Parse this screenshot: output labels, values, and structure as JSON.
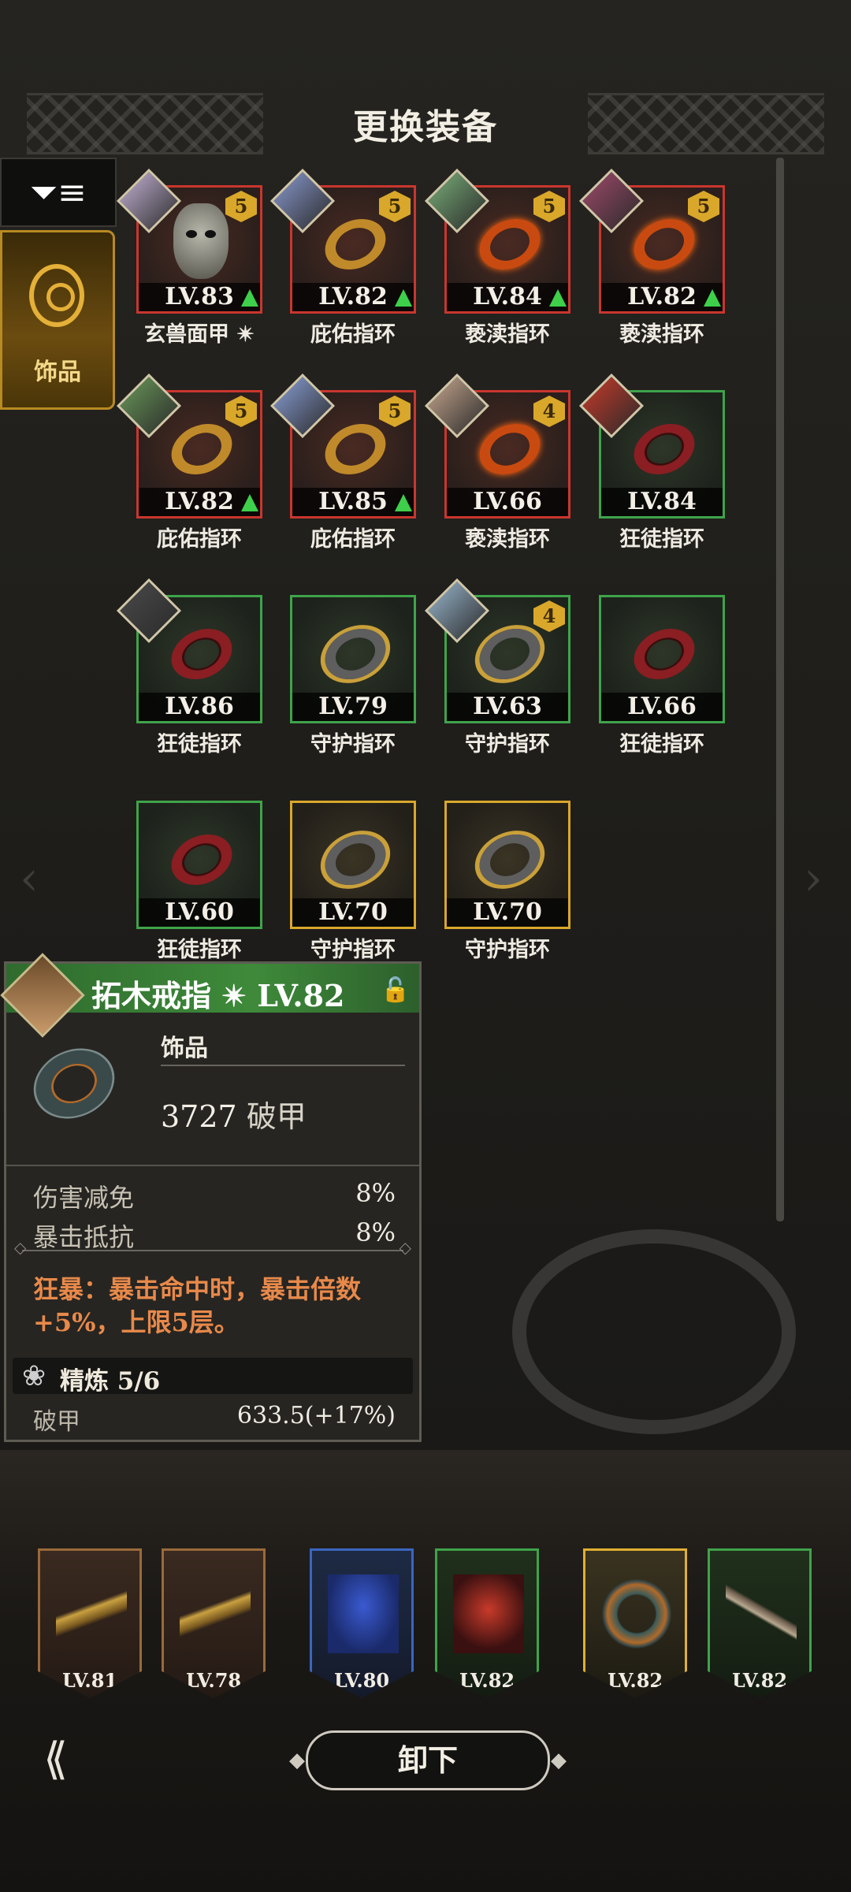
{
  "header": {
    "title": "更换装备"
  },
  "side": {
    "filter_icon": "filter-list-icon",
    "tab_label": "饰品"
  },
  "items": [
    {
      "name": "玄兽面甲 ✴",
      "level": "LV.83",
      "rarity": "red",
      "stars": "5",
      "upgrade": true,
      "type": "mask",
      "avatar": "#c6b4d8"
    },
    {
      "name": "庇佑指环",
      "level": "LV.82",
      "rarity": "red",
      "stars": "5",
      "upgrade": true,
      "type": "gold",
      "avatar": "#8a9ad0"
    },
    {
      "name": "亵渎指环",
      "level": "LV.84",
      "rarity": "red",
      "stars": "5",
      "upgrade": true,
      "type": "flame",
      "avatar": "#7ab07a"
    },
    {
      "name": "亵渎指环",
      "level": "LV.82",
      "rarity": "red",
      "stars": "5",
      "upgrade": true,
      "type": "flame",
      "avatar": "#a04a6a"
    },
    {
      "name": "庇佑指环",
      "level": "LV.82",
      "rarity": "red",
      "stars": "5",
      "upgrade": true,
      "type": "gold",
      "avatar": "#6a9a5a"
    },
    {
      "name": "庇佑指环",
      "level": "LV.85",
      "rarity": "red",
      "stars": "5",
      "upgrade": true,
      "type": "gold",
      "avatar": "#8aa0d8"
    },
    {
      "name": "亵渎指环",
      "level": "LV.66",
      "rarity": "red",
      "stars": "4",
      "upgrade": false,
      "type": "flame",
      "avatar": "#c8a890"
    },
    {
      "name": "狂徒指环",
      "level": "LV.84",
      "rarity": "green",
      "stars": "",
      "upgrade": false,
      "type": "red",
      "avatar": "#c83a2a"
    },
    {
      "name": "狂徒指环",
      "level": "LV.86",
      "rarity": "green",
      "stars": "",
      "upgrade": false,
      "type": "red",
      "avatar": "#4a4a4a"
    },
    {
      "name": "守护指环",
      "level": "LV.79",
      "rarity": "green",
      "stars": "",
      "upgrade": false,
      "type": "dark",
      "avatar": ""
    },
    {
      "name": "守护指环",
      "level": "LV.63",
      "rarity": "green",
      "stars": "4",
      "upgrade": false,
      "type": "dark",
      "avatar": "#9ab8d0"
    },
    {
      "name": "狂徒指环",
      "level": "LV.66",
      "rarity": "green",
      "stars": "",
      "upgrade": false,
      "type": "red",
      "avatar": ""
    },
    {
      "name": "狂徒指环",
      "level": "LV.60",
      "rarity": "green",
      "stars": "",
      "upgrade": false,
      "type": "red",
      "avatar": ""
    },
    {
      "name": "守护指环",
      "level": "LV.70",
      "rarity": "gold",
      "stars": "",
      "upgrade": false,
      "type": "dark",
      "avatar": ""
    },
    {
      "name": "守护指环",
      "level": "LV.70",
      "rarity": "gold",
      "stars": "",
      "upgrade": false,
      "type": "dark",
      "avatar": ""
    }
  ],
  "detail": {
    "title": "拓木戒指 ✴ LV.82",
    "type": "饰品",
    "main_value": "3727",
    "main_stat": "破甲",
    "stats": [
      {
        "label": "伤害减免",
        "value": "8%"
      },
      {
        "label": "暴击抵抗",
        "value": "8%"
      }
    ],
    "skill": "狂暴：暴击命中时，暴击倍数+5%，上限5层。",
    "refine": "精炼 5/6",
    "bottom_stat": {
      "label": "破甲",
      "value": "633.5(+17%)"
    }
  },
  "equipped": [
    {
      "level": "LV.81",
      "rarity": "brown",
      "art": "bow-icon"
    },
    {
      "level": "LV.78",
      "rarity": "brown",
      "art": "bow-icon"
    },
    {
      "level": "LV.80",
      "rarity": "blue",
      "art": "cloak-icon"
    },
    {
      "level": "LV.82",
      "rarity": "green",
      "art": "armor-icon"
    },
    {
      "level": "LV.82",
      "rarity": "gold",
      "art": "ring-icon"
    },
    {
      "level": "LV.82",
      "rarity": "green",
      "art": "crossbow-icon"
    }
  ],
  "footer": {
    "unequip_label": "卸下"
  }
}
